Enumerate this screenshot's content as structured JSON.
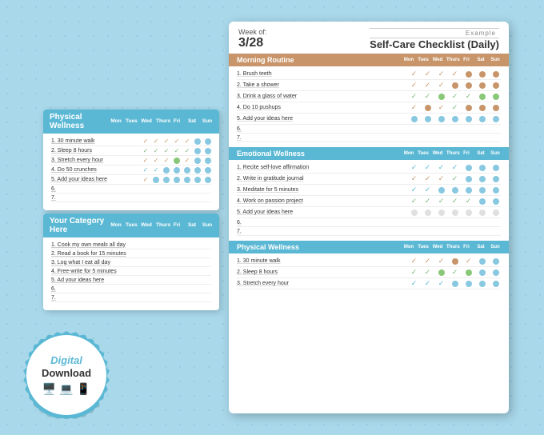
{
  "background": {
    "color": "#a8d8ea"
  },
  "left_cards": [
    {
      "id": "physical-wellness-card",
      "header": {
        "title": "Physical Wellness",
        "days": [
          "Mon",
          "Tues",
          "Wed",
          "Thurs",
          "Fri",
          "Sat",
          "Sun"
        ]
      },
      "rows": [
        {
          "num": "1.",
          "label": "30 minute walk",
          "checks": [
            "✓",
            "✓",
            "✓",
            "✓",
            "✓",
            "●",
            "●"
          ]
        },
        {
          "num": "2.",
          "label": "Sleep 8 hours",
          "checks": [
            "✓",
            "✓",
            "✓",
            "✓",
            "✓",
            "●",
            "●"
          ]
        },
        {
          "num": "3.",
          "label": "Stretch every hour",
          "checks": [
            "✓",
            "✓",
            "✓",
            "●",
            "✓",
            "●",
            "●"
          ]
        },
        {
          "num": "4.",
          "label": "Do 50 crunches",
          "checks": [
            "✓",
            "✓",
            "●",
            "●",
            "●",
            "●",
            "●"
          ]
        },
        {
          "num": "5.",
          "label": "Add your ideas here",
          "checks": [
            "✓",
            "●",
            "●",
            "●",
            "●",
            "●",
            "●"
          ]
        },
        {
          "num": "6.",
          "label": "",
          "checks": []
        },
        {
          "num": "7.",
          "label": "",
          "checks": []
        }
      ]
    },
    {
      "id": "your-category-card",
      "header": {
        "title": "Your Category Here",
        "days": [
          "Mon",
          "Tues",
          "Wed",
          "Thurs",
          "Fri",
          "Sat",
          "Sun"
        ]
      },
      "rows": [
        {
          "num": "1.",
          "label": "Cook my own meals all day",
          "checks": []
        },
        {
          "num": "2.",
          "label": "Read a book for 15 minutes",
          "checks": []
        },
        {
          "num": "3.",
          "label": "Log what I eat all day",
          "checks": []
        },
        {
          "num": "4.",
          "label": "Free-write for 5 minutes",
          "checks": []
        },
        {
          "num": "5.",
          "label": "Add your ideas here",
          "checks": []
        },
        {
          "num": "6.",
          "label": "",
          "checks": []
        },
        {
          "num": "7.",
          "label": "",
          "checks": []
        }
      ]
    }
  ],
  "main_card": {
    "week_label": "Week of:",
    "week_date": "3/28",
    "example_label": "Example",
    "title": "Self-Care Checklist (Daily)",
    "days": [
      "Mon",
      "Tues",
      "Wed",
      "Thurs",
      "Fri",
      "Sat",
      "Sun"
    ],
    "sections": [
      {
        "id": "morning-routine",
        "title": "Morning Routine",
        "color": "brown",
        "rows": [
          {
            "num": "1.",
            "label": "Brush teeth"
          },
          {
            "num": "2.",
            "label": "Take a shower"
          },
          {
            "num": "3.",
            "label": "Drink a glass of water"
          },
          {
            "num": "4.",
            "label": "Do 10 pushups"
          },
          {
            "num": "5.",
            "label": "Add your ideas here"
          },
          {
            "num": "6.",
            "label": ""
          },
          {
            "num": "7.",
            "label": ""
          }
        ]
      },
      {
        "id": "emotional-wellness",
        "title": "Emotional Wellness",
        "color": "blue",
        "rows": [
          {
            "num": "1.",
            "label": "Recite self-love affirmation"
          },
          {
            "num": "2.",
            "label": "Write in gratitude journal"
          },
          {
            "num": "3.",
            "label": "Meditate for 5 minutes"
          },
          {
            "num": "4.",
            "label": "Work on passion project"
          },
          {
            "num": "5.",
            "label": "Add your ideas here"
          },
          {
            "num": "6.",
            "label": ""
          },
          {
            "num": "7.",
            "label": ""
          }
        ]
      },
      {
        "id": "physical-wellness-main",
        "title": "Physical Wellness",
        "color": "blue",
        "rows": [
          {
            "num": "1.",
            "label": "30 minute walk"
          },
          {
            "num": "2.",
            "label": "Sleep 8 hours"
          },
          {
            "num": "3.",
            "label": "Stretch every hour"
          }
        ]
      }
    ]
  },
  "badge": {
    "line1": "Digital",
    "line2": "Download",
    "icons": [
      "🖥️",
      "💻",
      "📱"
    ]
  }
}
